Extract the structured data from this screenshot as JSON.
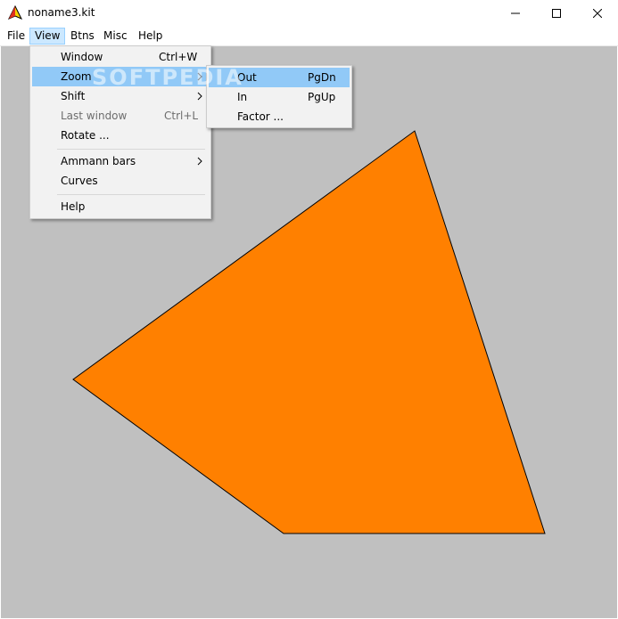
{
  "window": {
    "title": "noname3.kit",
    "icon": "kite-app-icon"
  },
  "menubar": {
    "items": [
      {
        "label": "File"
      },
      {
        "label": "View"
      },
      {
        "label": "Btns"
      },
      {
        "label": "Misc"
      },
      {
        "label": "Help"
      }
    ],
    "open": "View"
  },
  "view_menu": {
    "items": [
      {
        "label": "Window",
        "shortcut": "Ctrl+W"
      },
      {
        "label": "Zoom",
        "submenu": true,
        "highlighted": true
      },
      {
        "label": "Shift",
        "submenu": true
      },
      {
        "label": "Last window",
        "shortcut": "Ctrl+L",
        "disabled": true
      },
      {
        "label": "Rotate ..."
      },
      {
        "label": "Ammann bars",
        "submenu": true
      },
      {
        "label": "Curves"
      },
      {
        "label": "Help"
      }
    ]
  },
  "zoom_menu": {
    "items": [
      {
        "label": "Out",
        "shortcut": "PgDn",
        "highlighted": true
      },
      {
        "label": "In",
        "shortcut": "PgUp"
      },
      {
        "label": "Factor ..."
      }
    ]
  },
  "watermark": "SOFTPEDIA",
  "canvas": {
    "background": "#c0c0c0",
    "shape_fill": "#ff8000",
    "shape_stroke": "#000000"
  },
  "colors": {
    "menu_highlight": "#91c9f7",
    "menubar_active": "#cce8ff",
    "menu_background": "#f2f2f2",
    "disabled_text": "#6d6d6d"
  }
}
